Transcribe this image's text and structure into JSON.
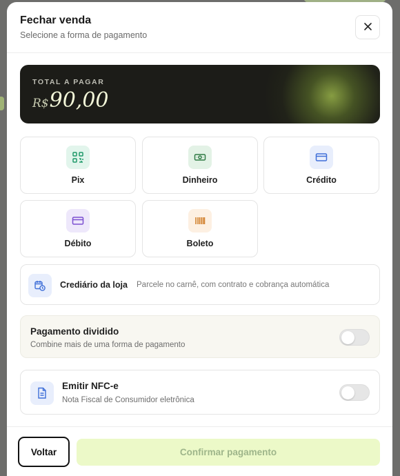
{
  "modal": {
    "title": "Fechar venda",
    "subtitle": "Selecione a forma de pagamento"
  },
  "total": {
    "label": "TOTAL A PAGAR",
    "currency": "R$",
    "amount": "90,00"
  },
  "payment_methods": [
    {
      "label": "Pix",
      "icon": "pix-qr-icon",
      "icon_bg": "#e2f5ec",
      "icon_color": "#1f9a6a"
    },
    {
      "label": "Dinheiro",
      "icon": "cash-icon",
      "icon_bg": "#e3f2e6",
      "icon_color": "#2f7a44"
    },
    {
      "label": "Crédito",
      "icon": "credit-card-icon",
      "icon_bg": "#e8eefc",
      "icon_color": "#3f6fd8"
    },
    {
      "label": "Débito",
      "icon": "debit-card-icon",
      "icon_bg": "#eee8fb",
      "icon_color": "#7b4fd1"
    },
    {
      "label": "Boleto",
      "icon": "barcode-icon",
      "icon_bg": "#fdf0e2",
      "icon_color": "#cf7a22"
    }
  ],
  "crediario": {
    "label": "Crediário da loja",
    "description": "Parcele no carnê, com contrato e cobrança automática",
    "icon": "calendar-clock-icon"
  },
  "split_payment": {
    "title": "Pagamento dividido",
    "description": "Combine mais de uma forma de pagamento",
    "enabled": false
  },
  "nfce": {
    "title": "Emitir NFC-e",
    "description": "Nota Fiscal de Consumidor eletrônica",
    "enabled": false,
    "icon": "document-icon"
  },
  "footer": {
    "back_label": "Voltar",
    "confirm_label": "Confirmar pagamento"
  },
  "colors": {
    "accent": "#ecf9c8",
    "total_bg": "#1c1c18"
  }
}
